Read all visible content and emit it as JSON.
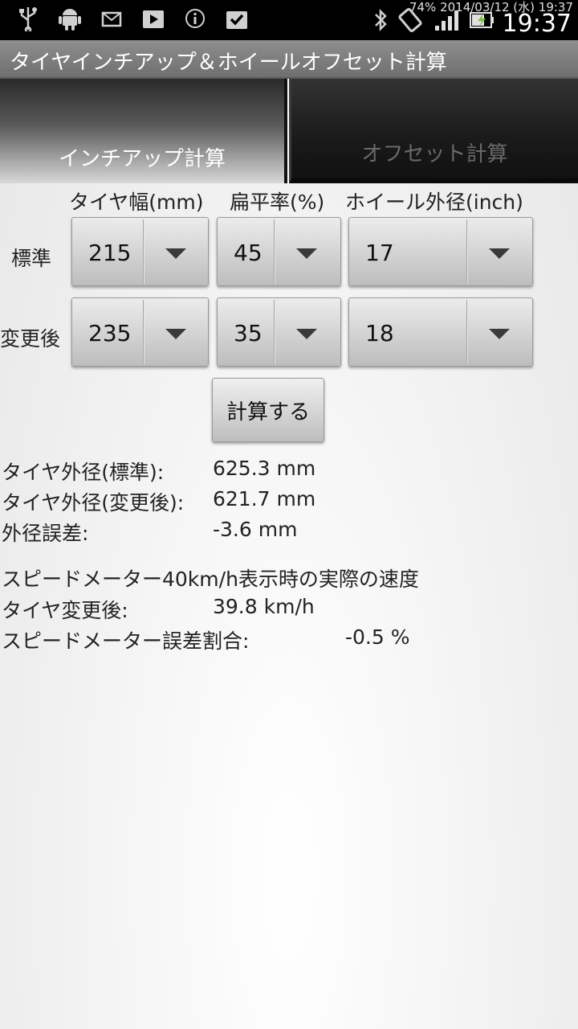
{
  "status_bar": {
    "battery_date": "74% 2014/03/12 (水) 19:37",
    "time": "19:37",
    "icons": [
      "usb-icon",
      "android-icon",
      "mail-icon",
      "play-store-icon",
      "info-icon",
      "task-check-icon",
      "bluetooth-icon",
      "rotate-icon",
      "signal-icon",
      "battery-icon"
    ]
  },
  "app": {
    "title": "タイヤインチアップ＆ホイールオフセット計算"
  },
  "tabs": [
    {
      "label": "インチアップ計算",
      "active": true
    },
    {
      "label": "オフセット計算",
      "active": false
    }
  ],
  "form": {
    "headers": {
      "width": "タイヤ幅(mm)",
      "aspect": "扁平率(%)",
      "wheel": "ホイール外径(inch)"
    },
    "rows": [
      {
        "label": "標準",
        "width": "215",
        "aspect": "45",
        "wheel": "17"
      },
      {
        "label": "変更後",
        "width": "235",
        "aspect": "35",
        "wheel": "18"
      }
    ],
    "calc_label": "計算する"
  },
  "results": {
    "std_diameter_label": "タイヤ外径(標準):",
    "std_diameter_value": "625.3 mm",
    "new_diameter_label": "タイヤ外径(変更後):",
    "new_diameter_value": "621.7 mm",
    "diff_label": "外径誤差:",
    "diff_value": "-3.6 mm",
    "speed_heading": "スピードメーター40km/h表示時の実際の速度",
    "new_speed_label": "タイヤ変更後:",
    "new_speed_value": "39.8 km/h",
    "speed_error_label": "スピードメーター誤差割合:",
    "speed_error_value": "-0.5 %"
  }
}
